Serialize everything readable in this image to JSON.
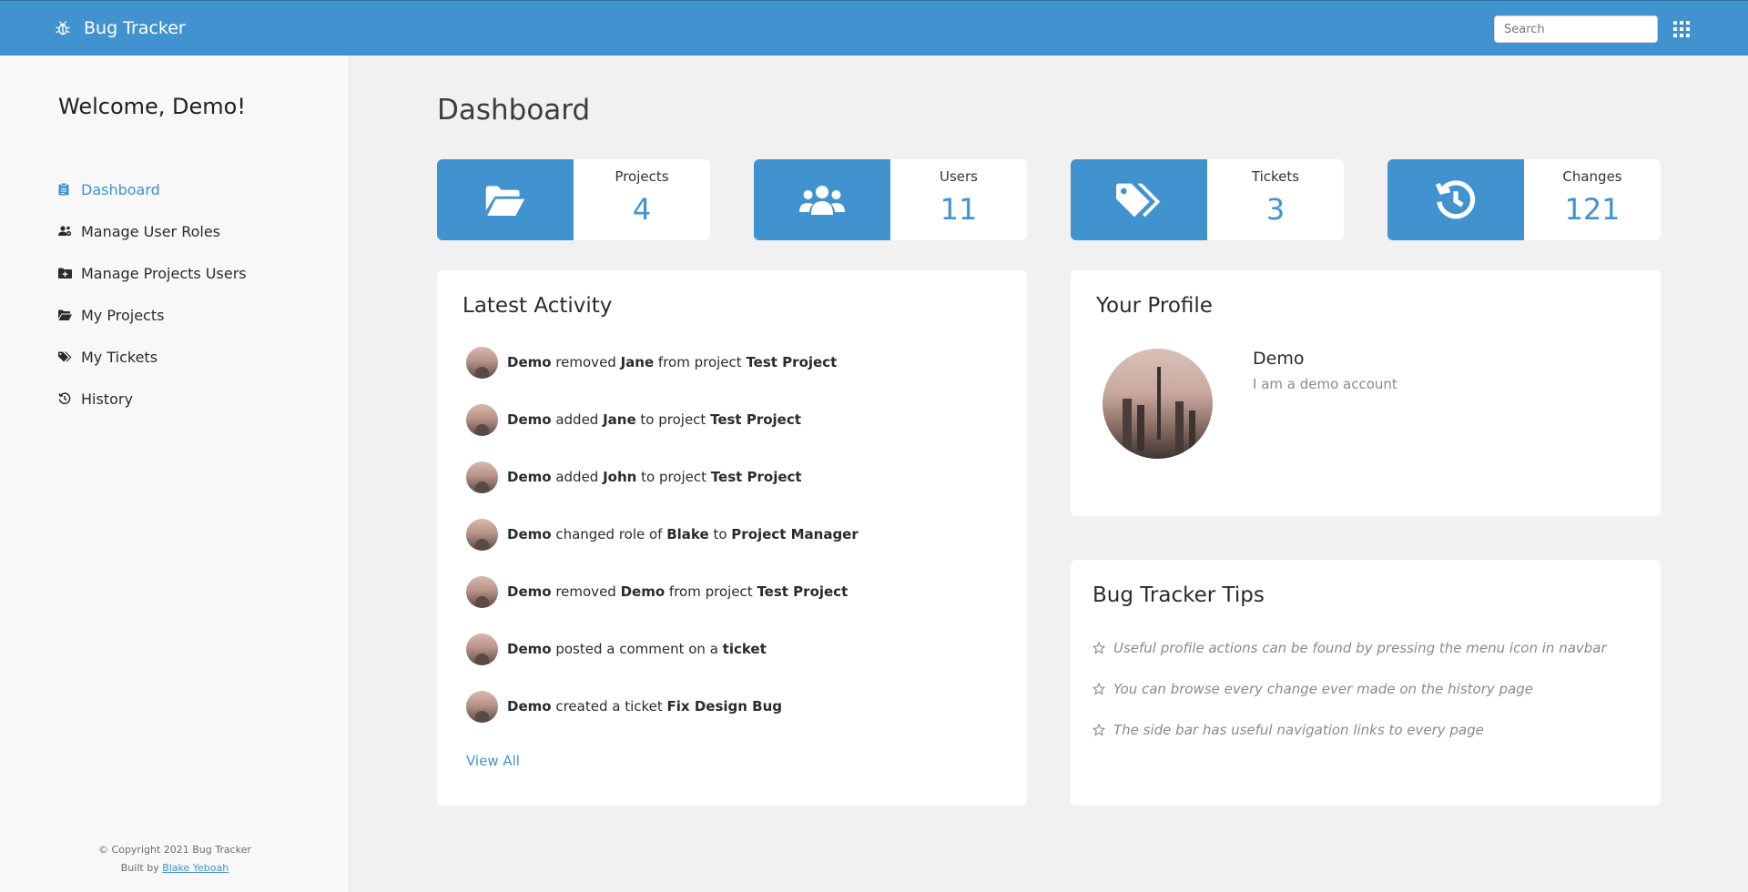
{
  "navbar": {
    "brand": "Bug Tracker",
    "search_placeholder": "Search"
  },
  "sidebar": {
    "welcome": "Welcome, Demo!",
    "items": [
      {
        "label": "Dashboard",
        "icon": "clipboard-icon",
        "active": true
      },
      {
        "label": "Manage User Roles",
        "icon": "users-cog-icon"
      },
      {
        "label": "Manage Projects Users",
        "icon": "folder-plus-icon"
      },
      {
        "label": "My Projects",
        "icon": "folder-open-icon"
      },
      {
        "label": "My Tickets",
        "icon": "tags-icon"
      },
      {
        "label": "History",
        "icon": "history-icon"
      }
    ],
    "footer": {
      "copyright": "© Copyright 2021 Bug Tracker",
      "built_by": "Built by",
      "author": "Blake Yeboah"
    }
  },
  "main": {
    "title": "Dashboard",
    "stats": [
      {
        "label": "Projects",
        "value": "4",
        "icon": "folder-open-icon"
      },
      {
        "label": "Users",
        "value": "11",
        "icon": "users-icon"
      },
      {
        "label": "Tickets",
        "value": "3",
        "icon": "tags-icon"
      },
      {
        "label": "Changes",
        "value": "121",
        "icon": "history-icon"
      }
    ],
    "activity": {
      "title": "Latest Activity",
      "items": [
        [
          {
            "t": "Demo",
            "b": true
          },
          {
            "t": " removed "
          },
          {
            "t": "Jane",
            "b": true
          },
          {
            "t": " from project "
          },
          {
            "t": "Test Project",
            "b": true
          }
        ],
        [
          {
            "t": "Demo",
            "b": true
          },
          {
            "t": " added "
          },
          {
            "t": "Jane",
            "b": true
          },
          {
            "t": " to project "
          },
          {
            "t": "Test Project",
            "b": true
          }
        ],
        [
          {
            "t": "Demo",
            "b": true
          },
          {
            "t": " added "
          },
          {
            "t": "John",
            "b": true
          },
          {
            "t": " to project "
          },
          {
            "t": "Test Project",
            "b": true
          }
        ],
        [
          {
            "t": "Demo",
            "b": true
          },
          {
            "t": " changed role of "
          },
          {
            "t": "Blake",
            "b": true
          },
          {
            "t": " to "
          },
          {
            "t": "Project Manager",
            "b": true
          }
        ],
        [
          {
            "t": "Demo",
            "b": true
          },
          {
            "t": " removed "
          },
          {
            "t": "Demo",
            "b": true
          },
          {
            "t": " from project "
          },
          {
            "t": "Test Project",
            "b": true
          }
        ],
        [
          {
            "t": "Demo",
            "b": true
          },
          {
            "t": " posted a comment on a "
          },
          {
            "t": "ticket",
            "b": true
          }
        ],
        [
          {
            "t": "Demo",
            "b": true
          },
          {
            "t": " created a ticket "
          },
          {
            "t": "Fix Design Bug",
            "b": true
          }
        ]
      ],
      "view_all": "View All"
    },
    "profile": {
      "title": "Your Profile",
      "name": "Demo",
      "bio": "I am a demo account"
    },
    "tips": {
      "title": "Bug Tracker Tips",
      "items": [
        "Useful profile actions can be found by pressing the menu icon in navbar",
        "You can browse every change ever made on the history page",
        "The side bar has useful navigation links to every page"
      ]
    }
  },
  "colors": {
    "accent": "#4193d0",
    "background": "#f1f1f1",
    "sidebar": "#f8f8f8"
  }
}
